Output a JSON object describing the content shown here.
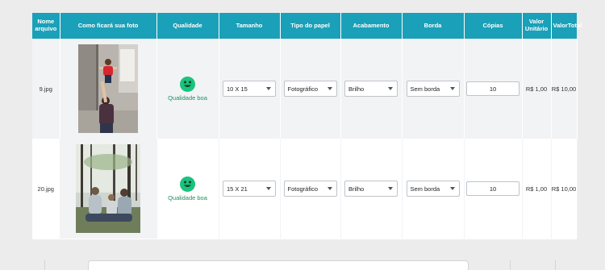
{
  "table": {
    "headers": [
      "Nome arquivo",
      "Como ficará sua foto",
      "Qualidade",
      "Tamanho",
      "Tipo do papel",
      "Acabamento",
      "Borda",
      "Cópias",
      "Valor Unitário",
      "ValorTotal"
    ],
    "rows": [
      {
        "filename": "9.jpg",
        "photo_icon": "photo-child-thumbnail",
        "quality_icon": "smiley-happy-icon",
        "quality": "Qualidade boa",
        "size": "10 X 15",
        "paper": "Fotográfico",
        "finish": "Brilho",
        "border": "Sem borda",
        "copies": "10",
        "unit_price": "R$ 1,00",
        "total": "R$ 10,00"
      },
      {
        "filename": "20.jpg",
        "photo_icon": "photo-family-forest-thumbnail",
        "quality_icon": "smiley-happy-icon",
        "quality": "Qualidade boa",
        "size": "15 X 21",
        "paper": "Fotográfico",
        "finish": "Brilho",
        "border": "Sem borda",
        "copies": "10",
        "unit_price": "R$ 1,00",
        "total": "R$ 10,00"
      }
    ]
  },
  "colors": {
    "header_bg": "#1aa0b8",
    "quality_good": "#19c37d",
    "page_bg": "#ececec"
  }
}
